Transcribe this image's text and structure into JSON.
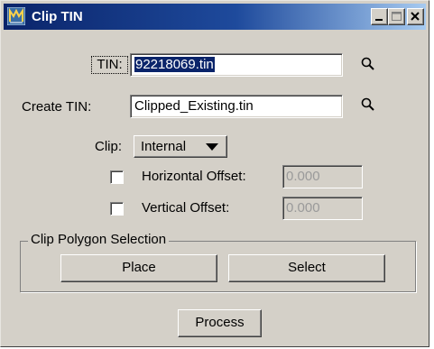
{
  "window": {
    "title": "Clip TIN",
    "controls": [
      "minimize-icon",
      "maximize-icon",
      "close-icon"
    ]
  },
  "form": {
    "tin_label": "TIN:",
    "tin_value": "92218069.tin",
    "create_tin_label": "Create TIN:",
    "create_tin_value": "Clipped_Existing.tin",
    "clip_label": "Clip:",
    "clip_value": "Internal",
    "horizontal_offset_label": "Horizontal Offset:",
    "horizontal_offset_value": "0.000",
    "horizontal_offset_checked": false,
    "vertical_offset_label": "Vertical Offset:",
    "vertical_offset_value": "0.000",
    "vertical_offset_checked": false
  },
  "clip_polygon": {
    "title": "Clip Polygon Selection",
    "place_label": "Place",
    "select_label": "Select"
  },
  "actions": {
    "process_label": "Process"
  },
  "colors": {
    "face": "#d4d0c8",
    "titlebar_start": "#0a246a",
    "titlebar_end": "#a6caf0",
    "selection": "#0a246a"
  }
}
